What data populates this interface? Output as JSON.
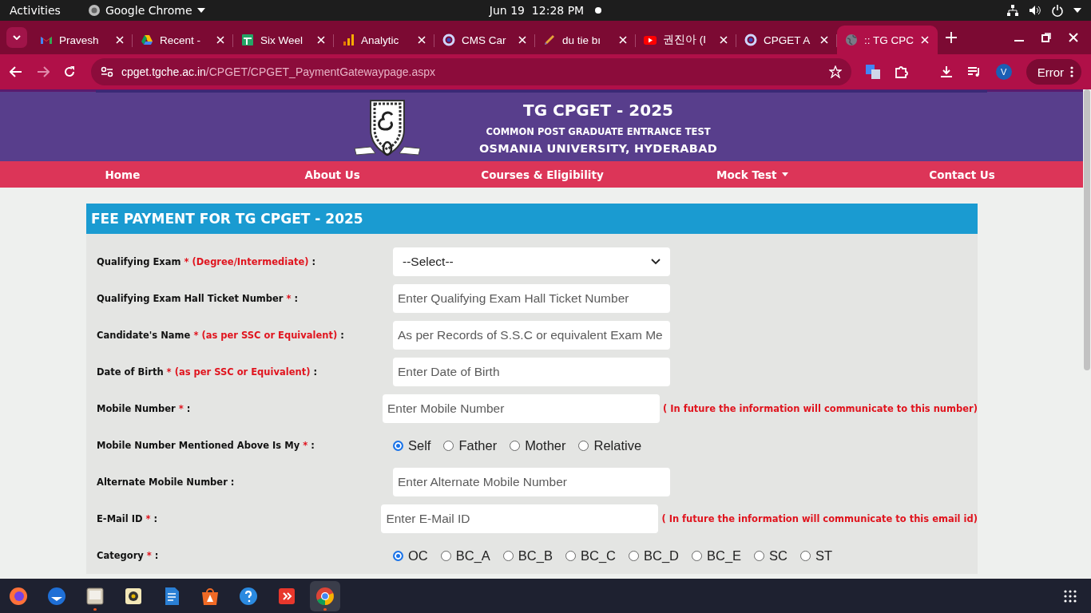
{
  "top_bar": {
    "activities": "Activities",
    "app": "Google Chrome",
    "clock": "Jun 19  12:28 PM"
  },
  "tabs": [
    {
      "kind": "gmail",
      "title": "Pravesh",
      "selected": false
    },
    {
      "kind": "drive",
      "title": "Recent -",
      "selected": false
    },
    {
      "kind": "sheets",
      "title": "Six Weel",
      "selected": false
    },
    {
      "kind": "analytics",
      "title": "Analytic",
      "selected": false
    },
    {
      "kind": "ring",
      "title": "CMS Car",
      "selected": false
    },
    {
      "kind": "pen",
      "title": "du tie bı",
      "selected": false
    },
    {
      "kind": "youtube",
      "title": "권진아 (I",
      "selected": false
    },
    {
      "kind": "ring",
      "title": "CPGET A",
      "selected": false
    },
    {
      "kind": "globe",
      "title": ":: TG CPC",
      "selected": true
    }
  ],
  "address_bar": {
    "domain": "cpget.tgche.ac.in",
    "path": "/CPGET/CPGET_PaymentGatewaypage.aspx"
  },
  "profile": "V",
  "error_button": "Error",
  "site": {
    "title": "TG CPGET - 2025",
    "subtitle": "COMMON POST GRADUATE ENTRANCE TEST",
    "university": "OSMANIA UNIVERSITY, HYDERABAD",
    "nav": [
      {
        "label": "Home",
        "dropdown": false
      },
      {
        "label": "About Us",
        "dropdown": false
      },
      {
        "label": "Courses & Eligibility",
        "dropdown": false
      },
      {
        "label": "Mock Test",
        "dropdown": true
      },
      {
        "label": "Contact Us",
        "dropdown": false
      }
    ]
  },
  "form": {
    "title": "FEE PAYMENT FOR TG CPGET - 2025",
    "rows": [
      {
        "kind": "select",
        "label": "Qualifying Exam",
        "required_mark": "*",
        "hint": "(Degree/Intermediate)",
        "colon": ":",
        "value": "--Select--"
      },
      {
        "kind": "text",
        "label": "Qualifying Exam Hall Ticket Number",
        "required_mark": "*",
        "colon": ":",
        "placeholder": "Enter Qualifying Exam Hall Ticket Number"
      },
      {
        "kind": "text",
        "label": "Candidate's Name",
        "required_mark": "*",
        "hint": "(as per SSC or Equivalent)",
        "colon": ":",
        "placeholder": "As per Records of S.S.C or equivalent Exam Me"
      },
      {
        "kind": "text",
        "label": "Date of Birth",
        "required_mark": "*",
        "hint": "(as per SSC or Equivalent)",
        "colon": ":",
        "placeholder": "Enter Date of Birth"
      },
      {
        "kind": "text",
        "label": "Mobile Number",
        "required_mark": "*",
        "colon": ":",
        "placeholder": "Enter Mobile Number",
        "note": "( In future the information will communicate to this number)"
      },
      {
        "kind": "radio",
        "label": "Mobile Number Mentioned Above Is My",
        "required_mark": "*",
        "colon": ":",
        "options": [
          {
            "label": "Self",
            "selected": true
          },
          {
            "label": "Father",
            "selected": false
          },
          {
            "label": "Mother",
            "selected": false
          },
          {
            "label": "Relative",
            "selected": false
          }
        ]
      },
      {
        "kind": "text",
        "label": "Alternate Mobile Number",
        "colon": ":",
        "placeholder": "Enter Alternate Mobile Number"
      },
      {
        "kind": "text",
        "label": "E-Mail ID",
        "required_mark": "*",
        "colon": ":",
        "placeholder": "Enter E-Mail ID",
        "note": "( In future the information will communicate to this email id)"
      },
      {
        "kind": "radio",
        "label": "Category",
        "required_mark": "*",
        "colon": ":",
        "options": [
          {
            "label": "OC",
            "selected": true
          },
          {
            "label": "BC_A",
            "selected": false
          },
          {
            "label": "BC_B",
            "selected": false
          },
          {
            "label": "BC_C",
            "selected": false
          },
          {
            "label": "BC_D",
            "selected": false
          },
          {
            "label": "BC_E",
            "selected": false
          },
          {
            "label": "SC",
            "selected": false
          },
          {
            "label": "ST",
            "selected": false
          }
        ]
      }
    ]
  },
  "dock": [
    {
      "kind": "firefox",
      "running": false,
      "selected": false
    },
    {
      "kind": "thunderbird",
      "running": false,
      "selected": false
    },
    {
      "kind": "files",
      "running": true,
      "selected": false
    },
    {
      "kind": "rhythmbox",
      "running": false,
      "selected": false
    },
    {
      "kind": "writer",
      "running": false,
      "selected": false
    },
    {
      "kind": "software",
      "running": false,
      "selected": false
    },
    {
      "kind": "help",
      "running": false,
      "selected": false
    },
    {
      "kind": "remote",
      "running": false,
      "selected": false
    },
    {
      "kind": "chrome",
      "running": true,
      "selected": true
    }
  ]
}
